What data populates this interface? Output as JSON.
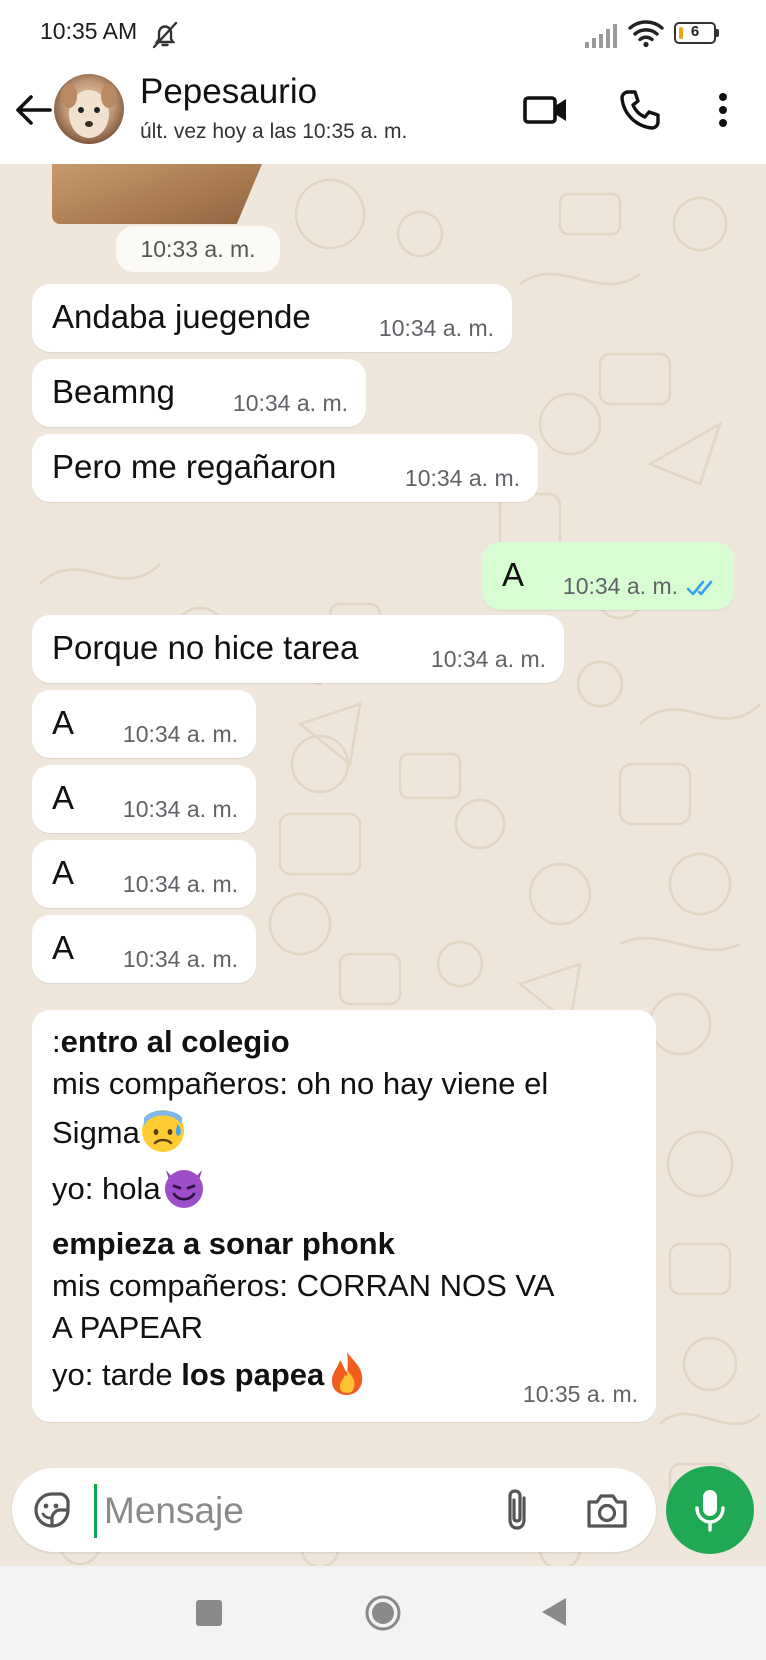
{
  "status_bar": {
    "time": "10:35 AM",
    "battery_level": "6",
    "icons": [
      "dnd-off-icon",
      "signal-icon",
      "wifi-icon",
      "battery-icon"
    ]
  },
  "header": {
    "contact_name": "Pepesaurio",
    "last_seen": "últ. vez hoy a las 10:35 a. m.",
    "icons": [
      "back-arrow-icon",
      "video-call-icon",
      "phone-icon",
      "more-vert-icon"
    ]
  },
  "chat": {
    "photo_time": "10:33 a. m.",
    "messages": [
      {
        "text": "Andaba juegende",
        "time": "10:34 a. m.",
        "direction": "in"
      },
      {
        "text": "Beamng",
        "time": "10:34 a. m.",
        "direction": "in"
      },
      {
        "text": "Pero me regañaron",
        "time": "10:34 a. m.",
        "direction": "in"
      },
      {
        "text": "A",
        "time": "10:34 a. m.",
        "direction": "out",
        "read": true
      },
      {
        "text": "Porque no hice tarea",
        "time": "10:34 a. m.",
        "direction": "in"
      },
      {
        "text": "A",
        "time": "10:34 a. m.",
        "direction": "in"
      },
      {
        "text": "A",
        "time": "10:34 a. m.",
        "direction": "in"
      },
      {
        "text": "A",
        "time": "10:34 a. m.",
        "direction": "in"
      },
      {
        "text": "A",
        "time": "10:34 a. m.",
        "direction": "in"
      }
    ],
    "long_message": {
      "line1_prefix": ":",
      "line1_bold": "entro al colegio",
      "line2": "mis compañeros: oh no hay viene el",
      "line3": "Sigma",
      "line4": "yo: hola",
      "line5_bold": "empieza a sonar phonk",
      "line6": "mis compañeros: CORRAN NOS VA",
      "line7": "A PAPEAR",
      "line8_prefix": "yo: tarde ",
      "line8_bold": "los papea",
      "time": "10:35 a. m.",
      "emojis": [
        "anxious-sweat-emoji",
        "smiling-devil-emoji",
        "fire-emoji"
      ]
    }
  },
  "composer": {
    "placeholder": "Mensaje",
    "icons": [
      "sticker-icon",
      "attach-clip-icon",
      "camera-icon",
      "mic-icon"
    ],
    "accent_color": "#1ea952"
  },
  "colors": {
    "chat_bg": "#efe7dc",
    "incoming_bubble": "#ffffff",
    "outgoing_bubble": "#d9fdd3",
    "read_ticks": "#34a0f0"
  }
}
